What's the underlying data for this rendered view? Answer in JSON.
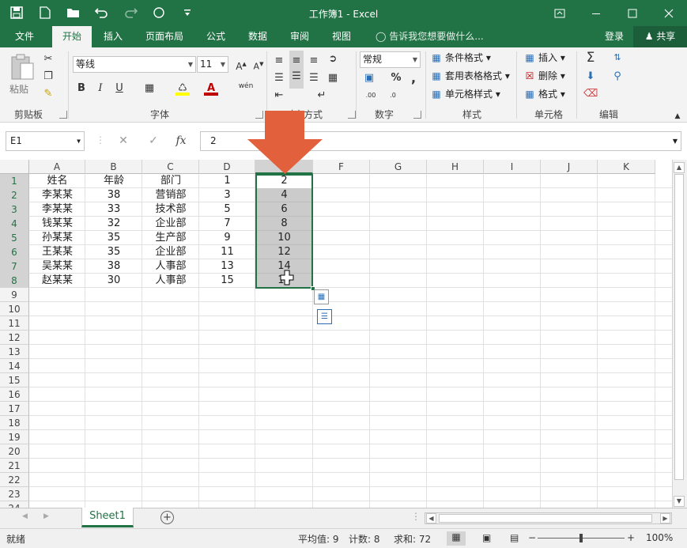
{
  "titlebar": {
    "title": "工作簿1 - Excel",
    "qat": [
      "save-icon",
      "new-icon",
      "open-icon",
      "undo-icon",
      "redo-icon",
      "circle-icon",
      "customize-icon"
    ],
    "window_buttons": [
      "ribbon-display-icon",
      "minimize-icon",
      "maximize-icon",
      "close-icon"
    ]
  },
  "tabs": {
    "items": [
      "文件",
      "开始",
      "插入",
      "页面布局",
      "公式",
      "数据",
      "审阅",
      "视图"
    ],
    "active": "开始",
    "tell_me": "告诉我您想要做什么...",
    "login": "登录",
    "share": "共享"
  },
  "ribbon": {
    "clipboard": {
      "paste": "粘贴",
      "label": "剪贴板"
    },
    "font": {
      "name": "等线",
      "size": "11",
      "bold": "B",
      "italic": "I",
      "underline": "U",
      "phonetic": "wén",
      "label": "字体"
    },
    "alignment": {
      "label": "对齐方式"
    },
    "number": {
      "format": "常规",
      "label": "数字"
    },
    "styles": {
      "conditional": "条件格式",
      "table": "套用表格格式",
      "cell": "单元格样式",
      "label": "样式"
    },
    "cells": {
      "insert": "插入",
      "delete": "删除",
      "format": "格式",
      "label": "单元格"
    },
    "editing": {
      "label": "编辑"
    }
  },
  "formula_bar": {
    "name_box": "E1",
    "cancel": "✕",
    "enter": "✓",
    "fx": "fx",
    "value": "2"
  },
  "grid": {
    "columns": [
      "A",
      "B",
      "C",
      "D",
      "E",
      "F",
      "G",
      "H",
      "I",
      "J",
      "K"
    ],
    "rows": [
      "1",
      "2",
      "3",
      "4",
      "5",
      "6",
      "7",
      "8",
      "9",
      "10",
      "11",
      "12",
      "13",
      "14",
      "15",
      "16",
      "17",
      "18",
      "19",
      "20",
      "21",
      "22",
      "23",
      "24"
    ],
    "data": [
      [
        "姓名",
        "年龄",
        "部门",
        "1",
        "2"
      ],
      [
        "李某某",
        "38",
        "营销部",
        "3",
        "4"
      ],
      [
        "李某某",
        "33",
        "技术部",
        "5",
        "6"
      ],
      [
        "钱某某",
        "32",
        "企业部",
        "7",
        "8"
      ],
      [
        "孙某某",
        "35",
        "生产部",
        "9",
        "10"
      ],
      [
        "王某某",
        "35",
        "企业部",
        "11",
        "12"
      ],
      [
        "吴某某",
        "38",
        "人事部",
        "13",
        "14"
      ],
      [
        "赵某某",
        "30",
        "人事部",
        "15",
        "16"
      ]
    ],
    "selection": "E1:E8",
    "selected_column": "E"
  },
  "sheets": {
    "tabs": [
      "Sheet1"
    ],
    "active": "Sheet1",
    "add": "+"
  },
  "status": {
    "ready": "就绪",
    "average": "平均值: 9",
    "count": "计数: 8",
    "sum": "求和: 72",
    "zoom": "100%",
    "zoom_out": "−",
    "zoom_in": "+"
  },
  "colors": {
    "accent": "#217346",
    "arrow": "#e2613c",
    "selection": "#a0a0a0"
  }
}
